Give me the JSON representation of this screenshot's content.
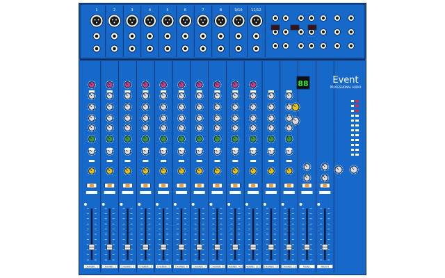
{
  "brand": {
    "name": "Event",
    "subtitle": "PROFESSIONAL AUDIO"
  },
  "display": {
    "preset_number": "88"
  },
  "channels": [
    {
      "number": "1",
      "strip_label": "CHANNEL 1"
    },
    {
      "number": "2",
      "strip_label": "CHANNEL 2"
    },
    {
      "number": "3",
      "strip_label": "CHANNEL 3"
    },
    {
      "number": "4",
      "strip_label": "CHANNEL 4"
    },
    {
      "number": "5",
      "strip_label": "CHANNEL 5"
    },
    {
      "number": "6",
      "strip_label": "CHANNEL 6"
    },
    {
      "number": "7",
      "strip_label": "CHANNEL 7"
    },
    {
      "number": "8",
      "strip_label": "CHANNEL 8"
    },
    {
      "number": "9/10",
      "strip_label": "CHANNEL 9/10"
    },
    {
      "number": "11/12",
      "strip_label": "CHANNEL 11/12"
    },
    {
      "number": "",
      "strip_label": "CHANNEL 13"
    },
    {
      "number": "",
      "strip_label": "CHANNEL 14"
    }
  ],
  "master": {
    "left_label": "MAIN L",
    "right_label": "MAIN R"
  },
  "fader_levels": [
    0.25,
    0.25,
    0.25,
    0.25,
    0.25,
    0.25,
    0.25,
    0.25,
    0.25,
    0.25,
    0.25,
    0.25,
    0.25,
    0.25
  ],
  "colors": {
    "panel": "#1769c9",
    "panel_dark": "#0b4f9e",
    "line": "#0a2a5e",
    "knob_gain": "#c23f8f",
    "knob_fx": "#3a9a3a",
    "knob_pan": "#e3c21b",
    "knob_grey": "#d9dce2",
    "display": "#101010",
    "display_digit": "#33ee33",
    "button_orange": "#f39a27"
  }
}
